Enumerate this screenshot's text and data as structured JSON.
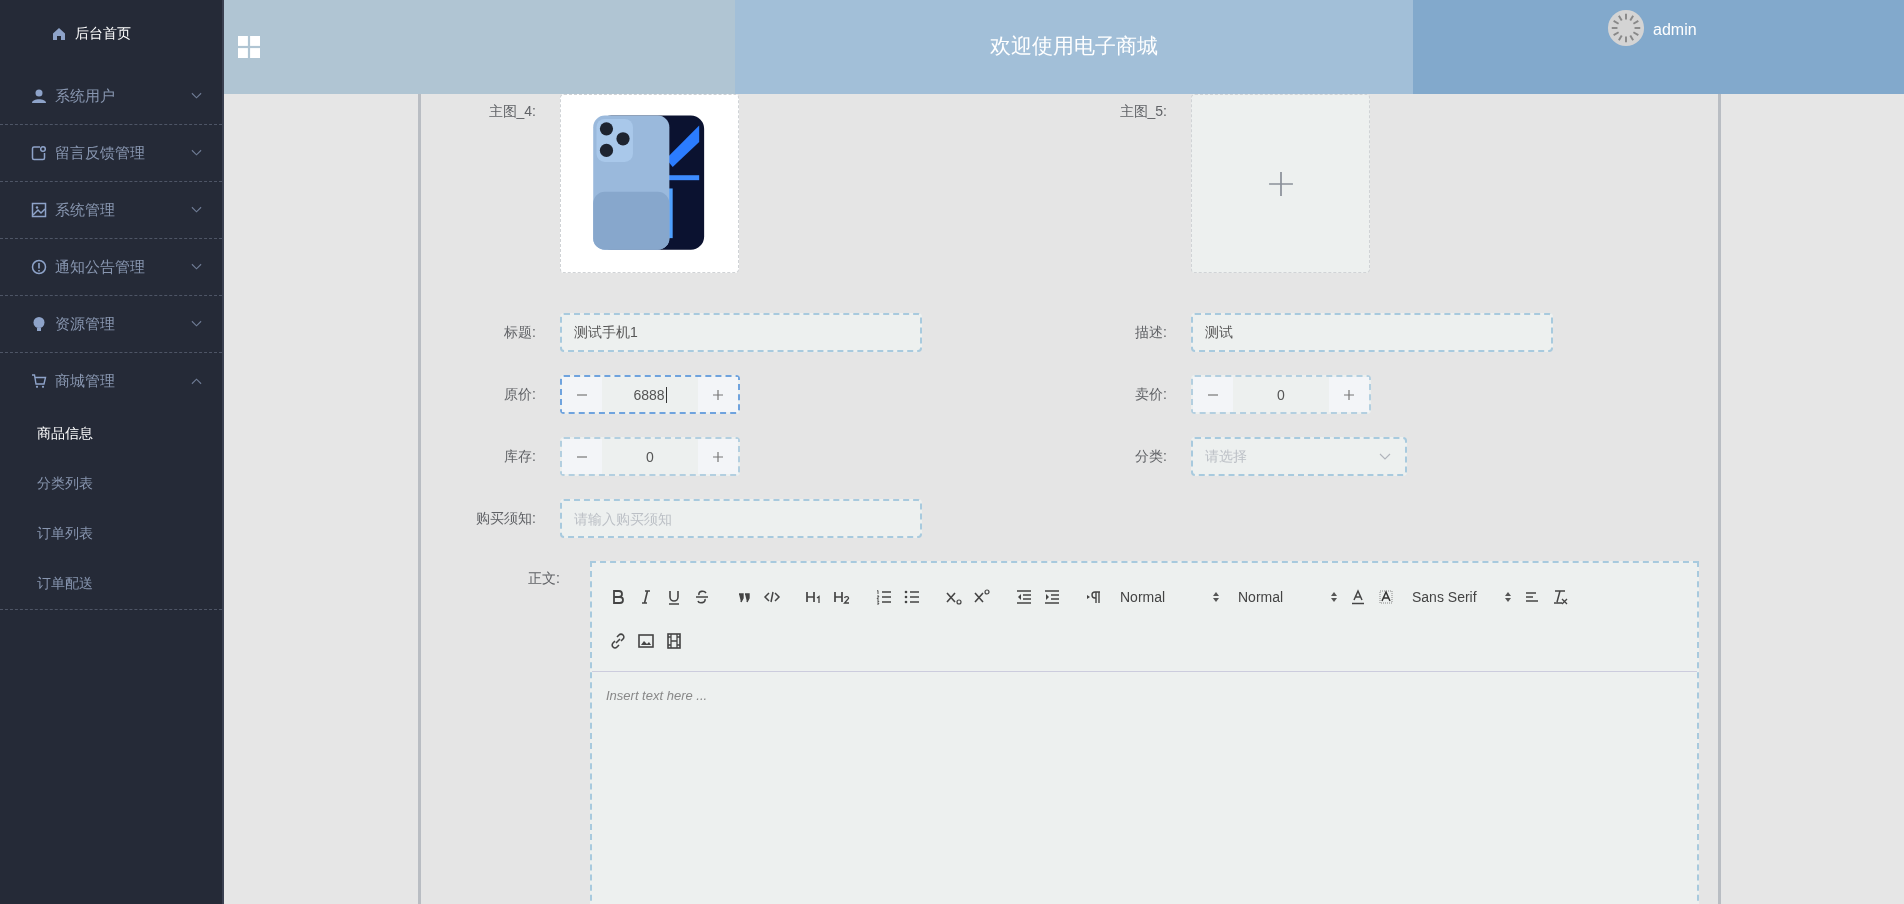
{
  "sidebar": {
    "home": "后台首页",
    "items": [
      {
        "label": "系统用户",
        "expanded": false
      },
      {
        "label": "留言反馈管理",
        "expanded": false
      },
      {
        "label": "系统管理",
        "expanded": false
      },
      {
        "label": "通知公告管理",
        "expanded": false
      },
      {
        "label": "资源管理",
        "expanded": false
      },
      {
        "label": "商城管理",
        "expanded": true,
        "children": [
          {
            "label": "商品信息",
            "selected": true
          },
          {
            "label": "分类列表",
            "selected": false
          },
          {
            "label": "订单列表",
            "selected": false
          },
          {
            "label": "订单配送",
            "selected": false
          }
        ]
      }
    ]
  },
  "header": {
    "title": "欢迎使用电子商城",
    "user": "admin"
  },
  "form": {
    "images": [
      {
        "label": "主图_4:",
        "kind": "picture"
      },
      {
        "label": "主图_5:",
        "kind": "empty"
      }
    ],
    "rows": [
      [
        {
          "label": "标题:",
          "kind": "text",
          "value": "测试手机1"
        },
        {
          "label": "描述:",
          "kind": "text",
          "value": "测试"
        }
      ],
      [
        {
          "label": "原价:",
          "kind": "number",
          "value": "6888",
          "focused": true
        },
        {
          "label": "卖价:",
          "kind": "number",
          "value": "0",
          "focused": false
        }
      ],
      [
        {
          "label": "库存:",
          "kind": "number",
          "value": "0",
          "focused": false
        },
        {
          "label": "分类:",
          "kind": "select",
          "placeholder": "请选择"
        }
      ],
      [
        {
          "label": "购买须知:",
          "kind": "text",
          "placeholder": "请输入购买须知"
        }
      ]
    ],
    "editor": {
      "label": "正文:",
      "pickers": [
        {
          "label": "Normal"
        },
        {
          "label": "Normal"
        },
        {
          "label": "Sans Serif"
        }
      ],
      "placeholder": "Insert text here ..."
    }
  }
}
